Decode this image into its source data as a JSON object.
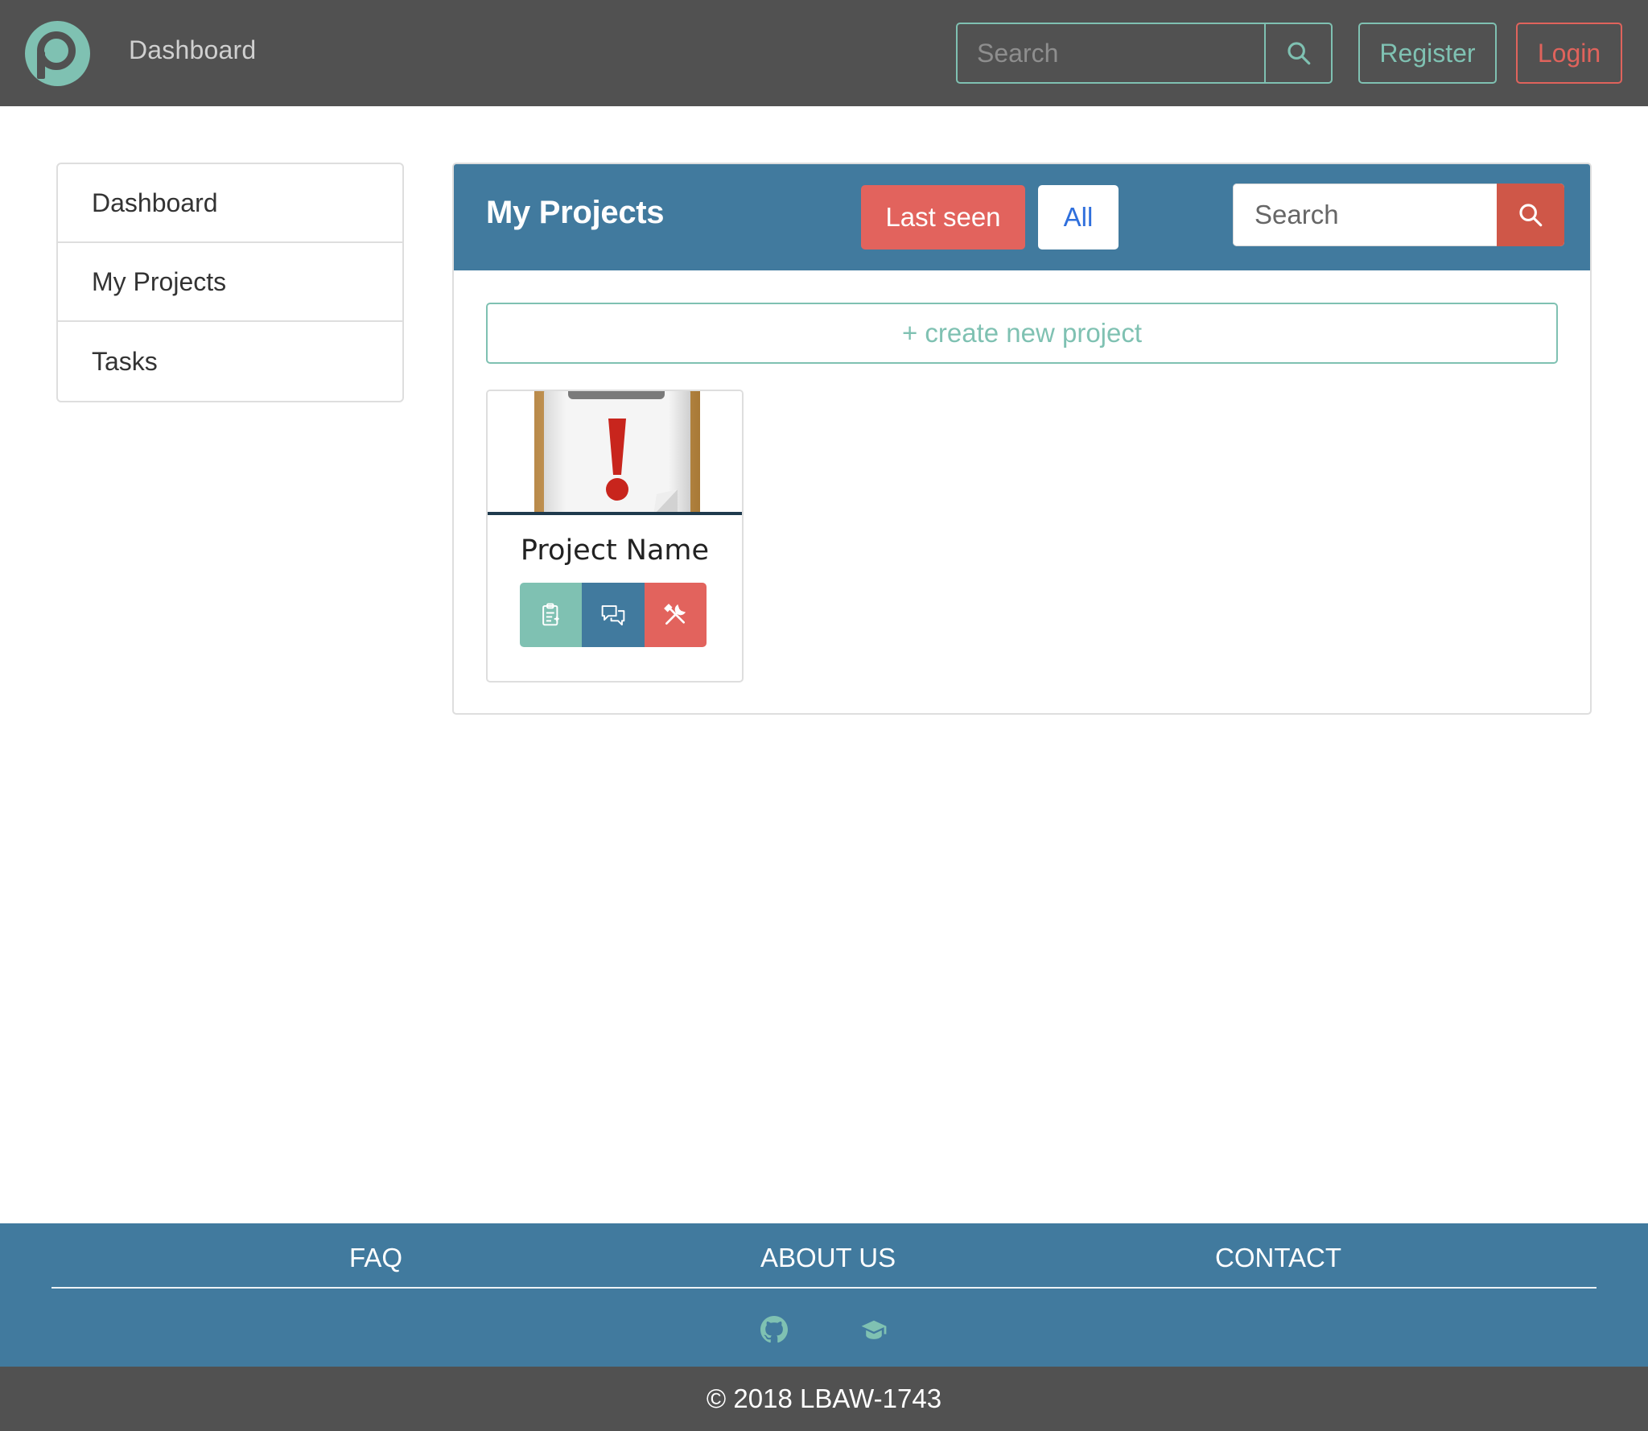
{
  "navbar": {
    "brand": "Dashboard",
    "logo_icon": "p-circle-logo",
    "search_placeholder": "Search",
    "register_label": "Register",
    "login_label": "Login"
  },
  "sidebar": {
    "items": [
      {
        "label": "Dashboard"
      },
      {
        "label": "My Projects"
      },
      {
        "label": "Tasks"
      }
    ]
  },
  "projects": {
    "title": "My Projects",
    "tabs": [
      {
        "label": "Last seen",
        "active": true
      },
      {
        "label": "All",
        "active": false
      }
    ],
    "search_placeholder": "Search",
    "create_label": "+ create new project",
    "cards": [
      {
        "name": "Project Name",
        "image_icon": "clipboard-alert-icon",
        "actions": [
          "clipboard-icon",
          "chat-icon",
          "tools-icon"
        ]
      }
    ]
  },
  "footer": {
    "links": [
      "FAQ",
      "ABOUT US",
      "CONTACT"
    ],
    "icons": [
      "github-icon",
      "graduation-cap-icon"
    ],
    "copyright": "© 2018 LBAW-1743"
  },
  "colors": {
    "navbar_bg": "#515151",
    "teal": "#7fc1b2",
    "blue": "#417a9e",
    "red": "#e2635d",
    "search_red": "#cf5748"
  }
}
